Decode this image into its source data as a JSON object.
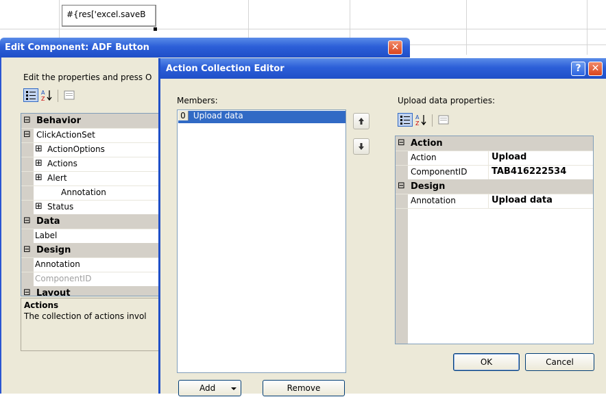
{
  "sheet": {
    "cell_text": "#{res['excel.saveB"
  },
  "edit_dialog": {
    "title": "Edit Component: ADF Button",
    "close_glyph": "✕",
    "instruction": "Edit the properties and press O",
    "rows": [
      {
        "label": "Behavior",
        "category": true,
        "expander": "⊟"
      },
      {
        "label": "ClickActionSet",
        "category": false,
        "expander": "⊟"
      },
      {
        "label": "ActionOptions",
        "category": false,
        "expander": "⊞",
        "indent": true
      },
      {
        "label": "Actions",
        "category": false,
        "expander": "⊞",
        "indent": true
      },
      {
        "label": "Alert",
        "category": false,
        "expander": "⊞",
        "indent": true
      },
      {
        "label": "Annotation",
        "category": false,
        "expander": "",
        "indent": true
      },
      {
        "label": "Status",
        "category": false,
        "expander": "⊞",
        "indent": true
      },
      {
        "label": "Data",
        "category": true,
        "expander": "⊟"
      },
      {
        "label": "Label",
        "category": false,
        "expander": ""
      },
      {
        "label": "Design",
        "category": true,
        "expander": "⊟"
      },
      {
        "label": "Annotation",
        "category": false,
        "expander": ""
      },
      {
        "label": "ComponentID",
        "category": false,
        "expander": "",
        "disabled": true
      },
      {
        "label": "Layout",
        "category": true,
        "expander": "⊟"
      }
    ],
    "description_title": "Actions",
    "description_text": "The collection of actions invol"
  },
  "ace": {
    "title": "Action Collection Editor",
    "help_glyph": "?",
    "close_glyph": "✕",
    "members_label": "Members:",
    "members": [
      {
        "index": "0",
        "text": "Upload data"
      }
    ],
    "props_label": "Upload data properties:",
    "props": [
      {
        "label": "Action",
        "category": true,
        "value": ""
      },
      {
        "label": "Action",
        "category": false,
        "value": "Upload"
      },
      {
        "label": "ComponentID",
        "category": false,
        "value": "TAB416222534"
      },
      {
        "label": "Design",
        "category": true,
        "value": ""
      },
      {
        "label": "Annotation",
        "category": false,
        "value": "Upload data"
      }
    ],
    "add_label": "Add",
    "remove_label": "Remove",
    "ok_label": "OK",
    "cancel_label": "Cancel",
    "up_glyph": "🡅",
    "down_glyph": "🡇"
  }
}
